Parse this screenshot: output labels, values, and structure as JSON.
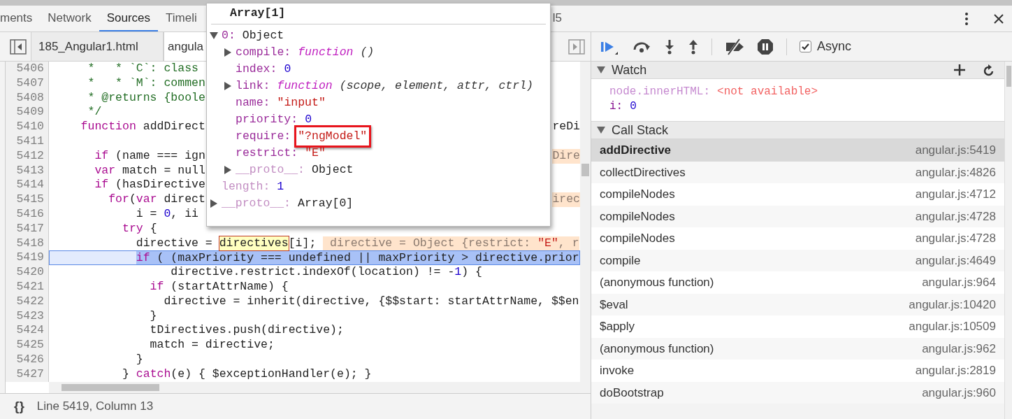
{
  "top_tabs": [
    {
      "label": "ments",
      "selected": false
    },
    {
      "label": "Network",
      "selected": false
    },
    {
      "label": "Sources",
      "selected": true
    },
    {
      "label": "Timeli",
      "selected": false
    },
    {
      "label": "l5",
      "selected": false
    }
  ],
  "file_tabs": [
    {
      "label": "185_Angular1.html",
      "selected": false
    },
    {
      "label": "angula",
      "selected": true
    }
  ],
  "code": {
    "lines": [
      {
        "number": "5406",
        "current": false,
        "segments": [
          {
            "text": "     *   * `C`: class",
            "kind": "comment"
          }
        ]
      },
      {
        "number": "5407",
        "current": false,
        "segments": [
          {
            "text": "     *   * `M`: commen",
            "kind": "comment"
          }
        ]
      },
      {
        "number": "5408",
        "current": false,
        "segments": [
          {
            "text": "     * @returns {boole",
            "kind": "comment"
          }
        ]
      },
      {
        "number": "5409",
        "current": false,
        "segments": [
          {
            "text": "     */",
            "kind": "comment"
          }
        ]
      },
      {
        "number": "5410",
        "current": false,
        "segments": [
          {
            "text": "    function",
            "kind": "keyword"
          },
          {
            "text": " addDirect",
            "kind": "text"
          }
        ],
        "tail": [
          {
            "text": "reDi",
            "kind": "text"
          }
        ]
      },
      {
        "number": "5411",
        "current": false
      },
      {
        "number": "5412",
        "current": false,
        "segments": [
          {
            "text": "      if",
            "kind": "keyword"
          },
          {
            "text": " (name === ign",
            "kind": "text"
          }
        ],
        "tail": [
          {
            "text": "Dire",
            "kind": "value"
          }
        ]
      },
      {
        "number": "5413",
        "current": false,
        "segments": [
          {
            "text": "      var",
            "kind": "keyword"
          },
          {
            "text": " match = null",
            "kind": "text"
          }
        ]
      },
      {
        "number": "5414",
        "current": false,
        "segments": [
          {
            "text": "      if",
            "kind": "keyword"
          },
          {
            "text": " (hasDirective",
            "kind": "text"
          }
        ]
      },
      {
        "number": "5415",
        "current": false,
        "segments": [
          {
            "text": "        for",
            "kind": "keyword"
          },
          {
            "text": "(",
            "kind": "text"
          },
          {
            "text": "var",
            "kind": "keyword"
          },
          {
            "text": " direct",
            "kind": "text"
          }
        ],
        "tail": [
          {
            "text": "irec",
            "kind": "value"
          }
        ]
      },
      {
        "number": "5416",
        "current": false,
        "segments": [
          {
            "text": "            i = ",
            "kind": "text"
          },
          {
            "text": "0",
            "kind": "number"
          },
          {
            "text": ", ii",
            "kind": "text"
          }
        ]
      },
      {
        "number": "5417",
        "current": false,
        "segments": [
          {
            "text": "          try",
            "kind": "keyword"
          },
          {
            "text": " {",
            "kind": "text"
          }
        ]
      },
      {
        "number": "5418",
        "current": false,
        "segments": [
          {
            "text": "            directive = ",
            "kind": "text"
          },
          {
            "text": "directives",
            "kind": "watch"
          },
          {
            "text": "[i]; ",
            "kind": "text"
          },
          {
            "text": " directive = Object {restrict: ",
            "kind": "value"
          },
          {
            "text": "\"E\"",
            "kind": "value-string"
          },
          {
            "text": ", r",
            "kind": "value"
          }
        ]
      },
      {
        "number": "5419",
        "current": true,
        "segments": [
          {
            "text": "            if",
            "kind": "keyword"
          },
          {
            "text": " ( (maxPriority === undefined || maxPriority > directive.prior",
            "kind": "text"
          }
        ]
      },
      {
        "number": "5420",
        "current": false,
        "segments": [
          {
            "text": "                 directive.restrict.indexOf(location) != -",
            "kind": "text"
          },
          {
            "text": "1",
            "kind": "number"
          },
          {
            "text": ") {",
            "kind": "text"
          }
        ]
      },
      {
        "number": "5421",
        "current": false,
        "segments": [
          {
            "text": "              if",
            "kind": "keyword"
          },
          {
            "text": " (startAttrName) {",
            "kind": "text"
          }
        ]
      },
      {
        "number": "5422",
        "current": false,
        "segments": [
          {
            "text": "                directive = inherit(directive, {$$start: startAttrName, $$en",
            "kind": "text"
          }
        ]
      },
      {
        "number": "5423",
        "current": false,
        "segments": [
          {
            "text": "              }",
            "kind": "text"
          }
        ]
      },
      {
        "number": "5424",
        "current": false,
        "segments": [
          {
            "text": "              tDirectives.push(directive);",
            "kind": "text"
          }
        ]
      },
      {
        "number": "5425",
        "current": false,
        "segments": [
          {
            "text": "              match = directive;",
            "kind": "text"
          }
        ]
      },
      {
        "number": "5426",
        "current": false,
        "segments": [
          {
            "text": "            }",
            "kind": "text"
          }
        ]
      },
      {
        "number": "5427",
        "current": false,
        "segments": [
          {
            "text": "          } ",
            "kind": "text"
          },
          {
            "text": "catch",
            "kind": "keyword"
          },
          {
            "text": "(e) { $exceptionHandler(e); }",
            "kind": "text"
          }
        ]
      }
    ]
  },
  "popover": {
    "title": "Array[1]",
    "items": [
      {
        "key": "0:",
        "value": "Object",
        "kind": "object",
        "expanded": true,
        "dim": false,
        "annotated": false,
        "children": [
          {
            "key": "compile:",
            "value": "function",
            "signature": "()",
            "kind": "function",
            "expanded": false,
            "dim": false,
            "annotated": false
          },
          {
            "key": "index:",
            "value": "0",
            "kind": "number",
            "dim": false,
            "annotated": false
          },
          {
            "key": "link:",
            "value": "function",
            "signature": "(scope, element, attr, ctrl)",
            "kind": "function",
            "expanded": false,
            "dim": false,
            "annotated": false
          },
          {
            "key": "name:",
            "value": "\"input\"",
            "kind": "string",
            "dim": false,
            "annotated": false
          },
          {
            "key": "priority:",
            "value": "0",
            "kind": "number",
            "dim": false,
            "annotated": false
          },
          {
            "key": "require:",
            "value": "\"?ngModel\"",
            "kind": "string",
            "dim": false,
            "annotated": true
          },
          {
            "key": "restrict:",
            "value": "\"E\"",
            "kind": "string",
            "dim": false,
            "annotated": false
          },
          {
            "key": "__proto__:",
            "value": "Object",
            "kind": "object",
            "expanded": false,
            "dim": true,
            "annotated": false
          }
        ]
      },
      {
        "key": "length:",
        "value": "1",
        "kind": "number",
        "dim": true,
        "annotated": false
      },
      {
        "key": "__proto__:",
        "value": "Array[0]",
        "kind": "object",
        "expanded": false,
        "dim": true,
        "annotated": false
      }
    ]
  },
  "status_bar": {
    "format_button": "{}",
    "position": "Line 5419, Column 13"
  },
  "debugger": {
    "async": {
      "label": "Async",
      "checked": true
    },
    "watch": {
      "title": "Watch",
      "expanded": true,
      "items": [
        {
          "name": "node.innerHTML:",
          "value": "<not available>",
          "kind": "error"
        },
        {
          "name": "i:",
          "value": "0",
          "kind": "number"
        }
      ]
    },
    "call_stack": {
      "title": "Call Stack",
      "expanded": true,
      "frames": [
        {
          "name": "addDirective",
          "location": "angular.js:5419",
          "selected": true
        },
        {
          "name": "collectDirectives",
          "location": "angular.js:4826",
          "selected": false
        },
        {
          "name": "compileNodes",
          "location": "angular.js:4712",
          "selected": false
        },
        {
          "name": "compileNodes",
          "location": "angular.js:4728",
          "selected": false
        },
        {
          "name": "compileNodes",
          "location": "angular.js:4728",
          "selected": false
        },
        {
          "name": "compile",
          "location": "angular.js:4649",
          "selected": false
        },
        {
          "name": "(anonymous function)",
          "location": "angular.js:964",
          "selected": false
        },
        {
          "name": "$eval",
          "location": "angular.js:10420",
          "selected": false
        },
        {
          "name": "$apply",
          "location": "angular.js:10509",
          "selected": false
        },
        {
          "name": "(anonymous function)",
          "location": "angular.js:962",
          "selected": false
        },
        {
          "name": "invoke",
          "location": "angular.js:2819",
          "selected": false
        },
        {
          "name": "doBootstrap",
          "location": "angular.js:960",
          "selected": false
        }
      ]
    }
  }
}
